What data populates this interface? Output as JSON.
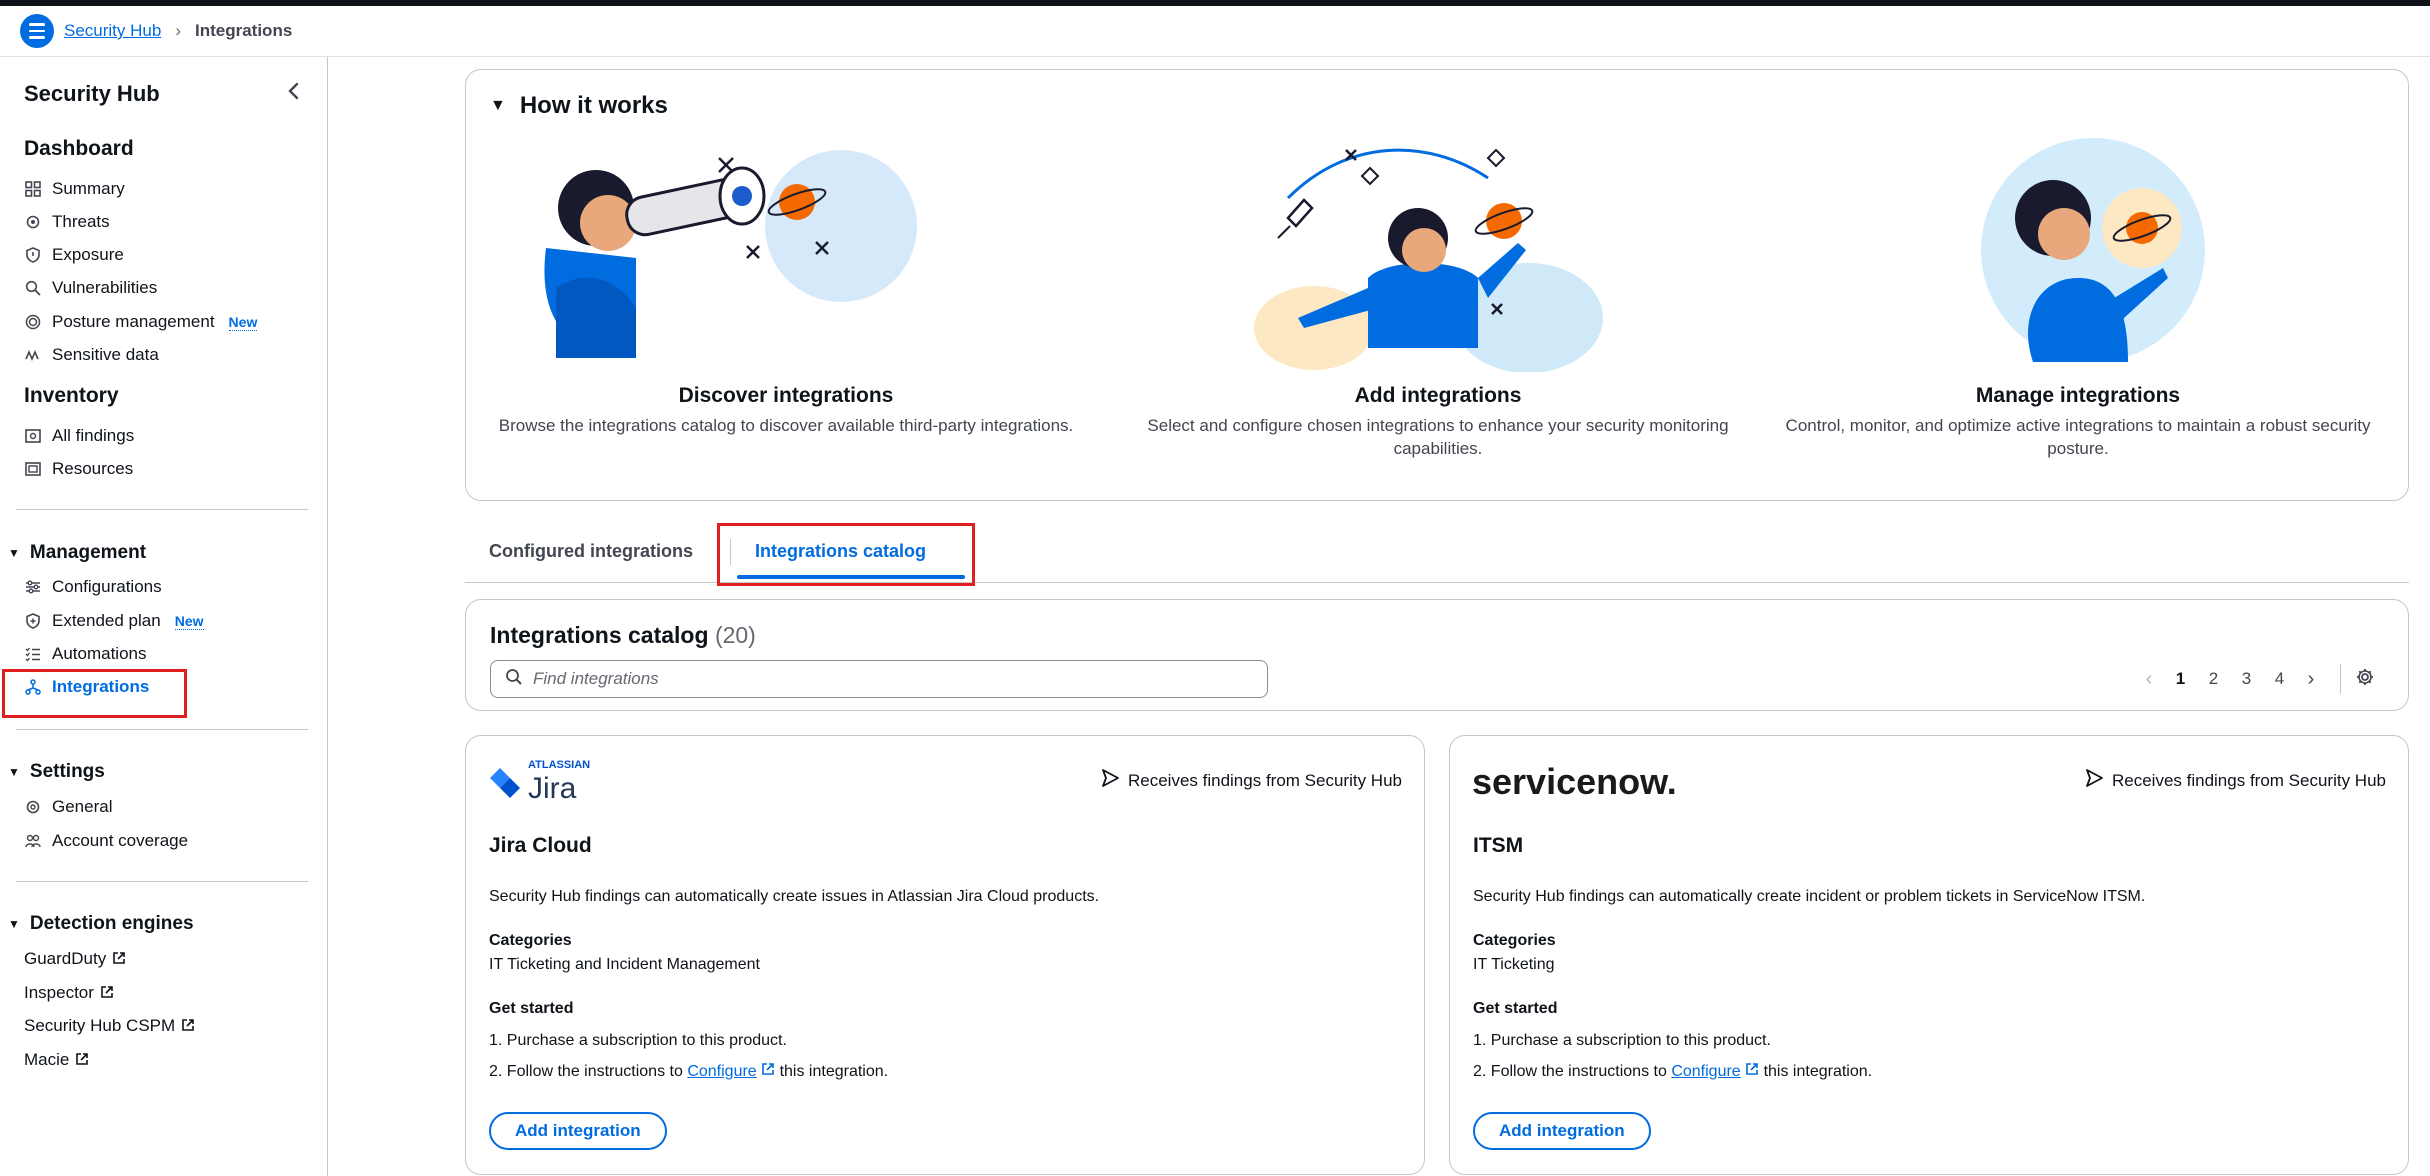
{
  "breadcrumb": {
    "root": "Security Hub",
    "current": "Integrations"
  },
  "sidebar": {
    "title": "Security Hub",
    "dashboard": {
      "heading": "Dashboard",
      "items": [
        "Summary",
        "Threats",
        "Exposure",
        "Vulnerabilities",
        "Posture management",
        "Sensitive data"
      ]
    },
    "new_badge": "New",
    "inventory": {
      "heading": "Inventory",
      "items": [
        "All findings",
        "Resources"
      ]
    },
    "management": {
      "heading": "Management",
      "items": [
        "Configurations",
        "Extended plan",
        "Automations",
        "Integrations"
      ]
    },
    "settings": {
      "heading": "Settings",
      "items": [
        "General",
        "Account coverage"
      ]
    },
    "detection": {
      "heading": "Detection engines",
      "items": [
        "GuardDuty",
        "Inspector",
        "Security Hub CSPM",
        "Macie"
      ]
    }
  },
  "how_it_works": {
    "title": "How it works",
    "columns": [
      {
        "title": "Discover integrations",
        "text": "Browse the integrations catalog to discover available third-party integrations."
      },
      {
        "title": "Add integrations",
        "text": "Select and configure chosen integrations to enhance your security monitoring capabilities."
      },
      {
        "title": "Manage integrations",
        "text": "Control, monitor, and optimize active integrations to maintain a robust security posture."
      }
    ]
  },
  "tabs": {
    "configured": "Configured integrations",
    "catalog": "Integrations catalog"
  },
  "catalog": {
    "title": "Integrations catalog",
    "count": "(20)",
    "search_placeholder": "Find integrations",
    "pages": [
      "1",
      "2",
      "3",
      "4"
    ],
    "current_page": 1
  },
  "cards": [
    {
      "logo_top": "ATLASSIAN",
      "logo_main": "Jira",
      "receives": "Receives findings from Security Hub",
      "name": "Jira Cloud",
      "description": "Security Hub findings can automatically create issues in Atlassian Jira Cloud products.",
      "categories_label": "Categories",
      "categories": "IT Ticketing and Incident Management",
      "get_started_label": "Get started",
      "step1": "1. Purchase a subscription to this product.",
      "step2_pre": "2. Follow the instructions to ",
      "step2_link": "Configure",
      "step2_post": " this integration.",
      "button": "Add integration"
    },
    {
      "logo_main": "servicenow.",
      "receives": "Receives findings from Security Hub",
      "name": "ITSM",
      "description": "Security Hub findings can automatically create incident or problem tickets in ServiceNow ITSM.",
      "categories_label": "Categories",
      "categories": "IT Ticketing",
      "get_started_label": "Get started",
      "step1": "1. Purchase a subscription to this product.",
      "step2_pre": "2. Follow the instructions to ",
      "step2_link": "Configure",
      "step2_post": " this integration.",
      "button": "Add integration"
    }
  ],
  "colors": {
    "accent": "#006ce0",
    "highlight": "#e02020",
    "text": "#0f141a",
    "border": "#c6c6cd"
  }
}
